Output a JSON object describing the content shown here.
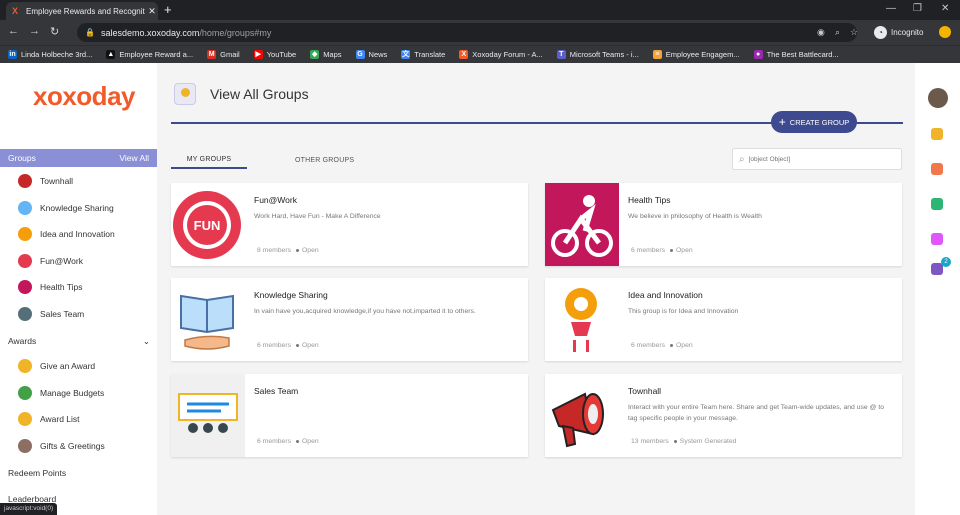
{
  "browser": {
    "tab_title": "Employee Rewards and Recognit",
    "tab_favicon": "X",
    "url_host": "salesdemo.xoxoday.com",
    "url_path": "/home/groups#my",
    "incognito_label": "Incognito",
    "bookmarks": [
      {
        "label": "Linda Holbeche 3rd...",
        "icon": "linkedin-icon",
        "color": "#0a66c2",
        "glyph": "in"
      },
      {
        "label": "Employee Reward a...",
        "icon": "bookmark-icon",
        "color": "#111111",
        "glyph": "▲"
      },
      {
        "label": "Gmail",
        "icon": "gmail-icon",
        "color": "#d93025",
        "glyph": "M"
      },
      {
        "label": "YouTube",
        "icon": "youtube-icon",
        "color": "#ff0000",
        "glyph": "▶"
      },
      {
        "label": "Maps",
        "icon": "maps-icon",
        "color": "#34a853",
        "glyph": "◆"
      },
      {
        "label": "News",
        "icon": "news-icon",
        "color": "#4285f4",
        "glyph": "G"
      },
      {
        "label": "Translate",
        "icon": "translate-icon",
        "color": "#4285f4",
        "glyph": "文"
      },
      {
        "label": "Xoxoday Forum - A...",
        "icon": "xoxoday-icon",
        "color": "#f25a2a",
        "glyph": "X"
      },
      {
        "label": "Microsoft Teams - i...",
        "icon": "teams-icon",
        "color": "#5b5fc7",
        "glyph": "T"
      },
      {
        "label": "Employee Engagem...",
        "icon": "engagement-icon",
        "color": "#f2a33a",
        "glyph": "≡"
      },
      {
        "label": "The Best Battlecard...",
        "icon": "battlecard-icon",
        "color": "#9c27b0",
        "glyph": "●"
      }
    ]
  },
  "sidebar": {
    "logo": "xoxoday",
    "groups_label": "Groups",
    "view_all": "View All",
    "group_items": [
      {
        "label": "Townhall",
        "icon": "megaphone-icon",
        "color": "#c62828"
      },
      {
        "label": "Knowledge Sharing",
        "icon": "book-icon",
        "color": "#64b5f6"
      },
      {
        "label": "Idea and Innovation",
        "icon": "rocket-icon",
        "color": "#f59e0b"
      },
      {
        "label": "Fun@Work",
        "icon": "fun-icon",
        "color": "#e53950"
      },
      {
        "label": "Health Tips",
        "icon": "cyclist-icon",
        "color": "#c2185b"
      },
      {
        "label": "Sales Team",
        "icon": "team-icon",
        "color": "#546e7a"
      }
    ],
    "awards_label": "Awards",
    "award_items": [
      {
        "label": "Give an Award",
        "icon": "award-icon",
        "color": "#f0b429"
      },
      {
        "label": "Manage Budgets",
        "icon": "budget-icon",
        "color": "#43a047"
      },
      {
        "label": "Award List",
        "icon": "list-icon",
        "color": "#f0b429"
      },
      {
        "label": "Gifts & Greetings",
        "icon": "gift-icon",
        "color": "#8d6e63"
      }
    ],
    "redeem_points": "Redeem Points",
    "leaderboard": "Leaderboard"
  },
  "main": {
    "page_title": "View All Groups",
    "create_group": "CREATE GROUP",
    "tabs": {
      "my_groups": "MY GROUPS",
      "other_groups": "OTHER GROUPS"
    },
    "search_placeholder": "[object Object]",
    "cards": [
      {
        "title": "Fun@Work",
        "desc": "Work Hard, Have Fun - Make A Difference",
        "members": "8 members",
        "status": "Open",
        "icon": "fun-icon"
      },
      {
        "title": "Health Tips",
        "desc": "We believe in philosophy of Health is Wealth",
        "members": "6 members",
        "status": "Open",
        "icon": "cyclist-icon"
      },
      {
        "title": "Knowledge Sharing",
        "desc": "In vain have you,acquired knowledge,if you have not,imparted it to others.",
        "members": "6 members",
        "status": "Open",
        "icon": "book-icon"
      },
      {
        "title": "Idea and Innovation",
        "desc": "This group is for Idea and Innovation",
        "members": "6 members",
        "status": "Open",
        "icon": "rocket-icon"
      },
      {
        "title": "Sales Team",
        "desc": "",
        "members": "6 members",
        "status": "Open",
        "icon": "team-icon"
      },
      {
        "title": "Townhall",
        "desc": "Interact with your entire Team here. Share and get Team-wide updates, and use @ to tag specific people in your message.",
        "members": "13 members",
        "status": "System Generated",
        "icon": "megaphone-icon"
      }
    ]
  },
  "right_rail": {
    "icons": [
      {
        "name": "search-icon",
        "color": "#f0b429"
      },
      {
        "name": "contacts-icon",
        "color": "#f2784b"
      },
      {
        "name": "bell-icon",
        "color": "#2bb673"
      },
      {
        "name": "cupcake-icon",
        "color": "#e056fd"
      },
      {
        "name": "calendar-icon",
        "color": "#7e57c2"
      }
    ],
    "badge_count": "2"
  },
  "statusbar": "javascript:void(0)",
  "colors": {
    "accent": "#3d4a8f",
    "brand": "#f25a2a",
    "group_header": "#8a8fd6"
  }
}
